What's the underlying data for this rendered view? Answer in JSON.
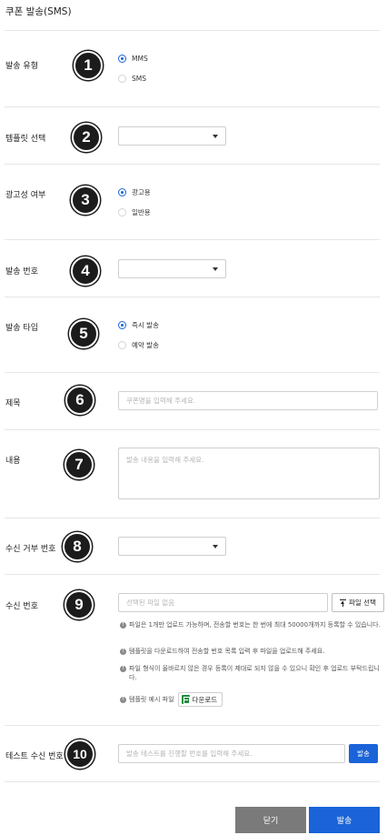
{
  "page_title": "쿠폰 발송(SMS)",
  "badges": [
    "1",
    "2",
    "3",
    "4",
    "5",
    "6",
    "7",
    "8",
    "9",
    "10"
  ],
  "send_type": {
    "label": "발송 유형",
    "options": [
      "MMS",
      "SMS"
    ],
    "selected": "MMS"
  },
  "template_select": {
    "label": "템플릿 선택",
    "value": ""
  },
  "ad_flag": {
    "label": "광고성 여부",
    "options": [
      "광고용",
      "일반용"
    ],
    "selected": "광고용"
  },
  "sender_number": {
    "label": "발송 번호",
    "value": ""
  },
  "send_timing": {
    "label": "발송 타입",
    "options": [
      "즉시 발송",
      "예약 발송"
    ],
    "selected": "즉시 발송"
  },
  "subject": {
    "label": "제목",
    "value": "",
    "placeholder": "쿠폰명을 입력해 주세요."
  },
  "content": {
    "label": "내용",
    "value": "",
    "placeholder": "발송 내용을 입력해 주세요."
  },
  "reject_number": {
    "label": "수신 거부 번호",
    "value": ""
  },
  "recipients": {
    "label": "수신 번호",
    "file_placeholder": "선택된 파일 없음",
    "file_button": "파일 선택",
    "notes": [
      "파일은 1개만 업로드 가능하며, 전송할 번호는 한 번에 최대 50000개까지 등록할 수 있습니다.",
      "템플릿을 다운로드하여 전송할 번호 목록 입력 후 파일을 업로드해 주세요.",
      "파일 형식이 올바르지 않은 경우 등록이 제대로 되지 않을 수 있으니 확인 후 업로드 부탁드립니다."
    ],
    "template_label": "템플릿 예시 파일",
    "download_button": "다운로드"
  },
  "test_number": {
    "label": "테스트 수신 번호",
    "placeholder": "발송 테스트를 진행할 번호를 입력해 주세요.",
    "button": "발송"
  },
  "footer": {
    "close": "닫기",
    "send": "발송"
  },
  "colors": {
    "primary": "#1a63d8",
    "secondary": "#7a7a7a",
    "badge": "#1c1c1c"
  }
}
